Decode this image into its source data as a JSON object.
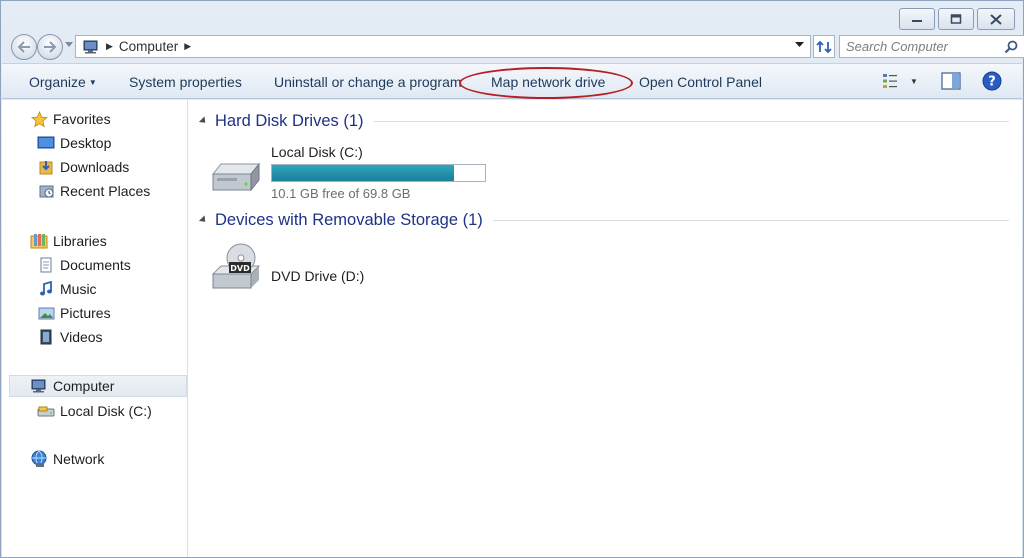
{
  "window": {
    "breadcrumb": "Computer",
    "search_placeholder": "Search Computer"
  },
  "toolbar": {
    "organize": "Organize",
    "system_properties": "System properties",
    "uninstall": "Uninstall or change a program",
    "map_network_drive": "Map network drive",
    "open_control_panel": "Open Control Panel"
  },
  "sidebar": {
    "favorites": {
      "label": "Favorites",
      "icon": "star-icon"
    },
    "favorites_items": [
      {
        "label": "Desktop",
        "icon": "desktop-icon"
      },
      {
        "label": "Downloads",
        "icon": "downloads-icon"
      },
      {
        "label": "Recent Places",
        "icon": "recent-places-icon"
      }
    ],
    "libraries": {
      "label": "Libraries",
      "icon": "libraries-icon"
    },
    "libraries_items": [
      {
        "label": "Documents",
        "icon": "documents-icon"
      },
      {
        "label": "Music",
        "icon": "music-icon"
      },
      {
        "label": "Pictures",
        "icon": "pictures-icon"
      },
      {
        "label": "Videos",
        "icon": "videos-icon"
      }
    ],
    "computer": {
      "label": "Computer",
      "icon": "computer-icon"
    },
    "computer_items": [
      {
        "label": "Local Disk (C:)",
        "icon": "local-disk-icon"
      }
    ],
    "network": {
      "label": "Network",
      "icon": "network-icon"
    }
  },
  "main": {
    "groups": [
      {
        "title": "Hard Disk Drives (1)",
        "items": [
          {
            "name": "Local Disk (C:)",
            "free_text": "10.1 GB free of 69.8 GB",
            "used_fraction": 0.855
          }
        ]
      },
      {
        "title": "Devices with Removable Storage (1)",
        "items": [
          {
            "name": "DVD Drive (D:)",
            "icon_text": "DVD"
          }
        ]
      }
    ]
  },
  "colors": {
    "accent_ring": "#b51f24",
    "group_title": "#1e3287",
    "capacity_fill": "#1b7f9b"
  }
}
